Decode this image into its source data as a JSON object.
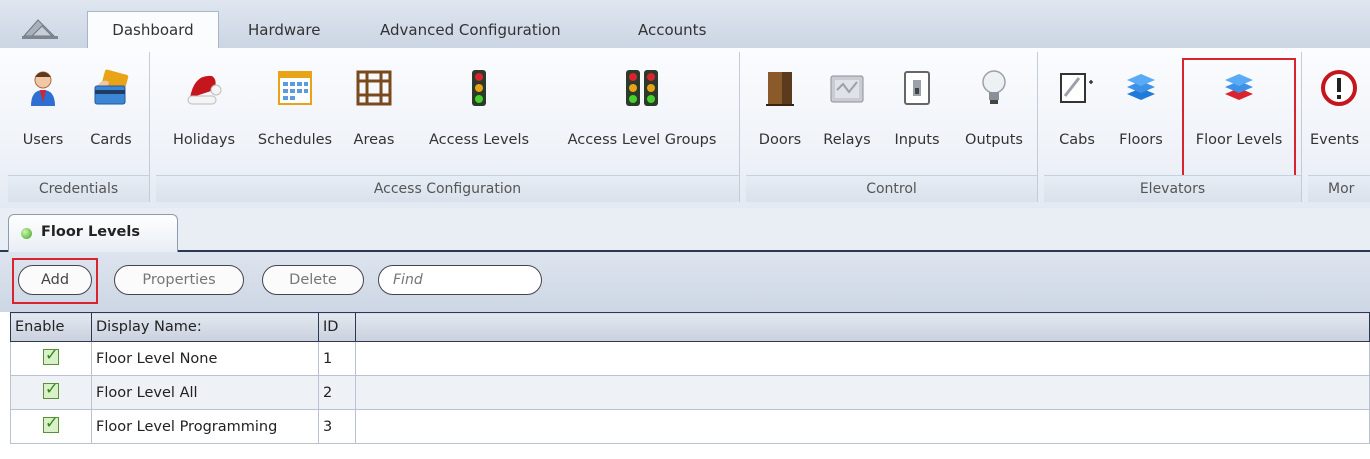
{
  "tabs": [
    "Dashboard",
    "Hardware",
    "Advanced Configuration",
    "Accounts"
  ],
  "ribbon": {
    "groups": {
      "credentials": {
        "label": "Credentials",
        "users": "Users",
        "cards": "Cards"
      },
      "access": {
        "label": "Access Configuration",
        "holidays": "Holidays",
        "schedules": "Schedules",
        "areas": "Areas",
        "access_levels": "Access Levels",
        "access_level_groups": "Access Level Groups"
      },
      "control": {
        "label": "Control",
        "doors": "Doors",
        "relays": "Relays",
        "inputs": "Inputs",
        "outputs": "Outputs"
      },
      "elevators": {
        "label": "Elevators",
        "cabs": "Cabs",
        "floors": "Floors",
        "floor_levels": "Floor Levels"
      },
      "monitoring": {
        "label": "Mor",
        "events": "Events"
      }
    }
  },
  "document_tab": {
    "title": "Floor Levels"
  },
  "toolbar": {
    "add": "Add",
    "properties": "Properties",
    "delete": "Delete",
    "find_placeholder": "Find"
  },
  "grid": {
    "columns": [
      "Enable",
      "Display Name:",
      "ID"
    ],
    "rows": [
      {
        "enabled": true,
        "name": "Floor Level None",
        "id": "1"
      },
      {
        "enabled": true,
        "name": "Floor Level All",
        "id": "2"
      },
      {
        "enabled": true,
        "name": "Floor Level Programming",
        "id": "3"
      }
    ]
  },
  "colors": {
    "highlight": "#d9232e",
    "ribbon_bg": "#eef2f8",
    "header_border": "#2b3a52"
  }
}
